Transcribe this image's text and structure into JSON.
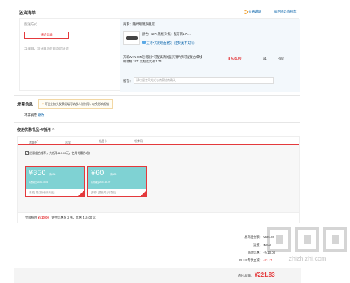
{
  "delivery": {
    "title": "送货清单",
    "price_note": "价格说明",
    "back_cart": "返回修改购物车",
    "method_label": "配送方式",
    "method_value": "快递运输",
    "delivery_time": "工作日、双休日与假日均可送货"
  },
  "item": {
    "seller": "商家：随昇眼镜旗舰店",
    "spec_line1": "颜色：1971黑框   对焦：配万新1.74...",
    "return_tag": "支持7天无理由退货（定制类不支持）",
    "name": "万新WAN XIN近视镜片可配高清防蓝光镜片男可配复古细线眼镜框 1971黑框 配万新1.74...",
    "price": "¥ 635.00",
    "qty": "x1",
    "stock": "有货",
    "remark_label": "留言：",
    "remark_placeholder": "请以留言同方式与商家协商确认"
  },
  "invoice": {
    "title": "发票信息",
    "notice": "开企业抬头发票须填写纳税人识别号，以免影响报销",
    "value": "不开发票",
    "edit": "修改"
  },
  "discount": {
    "title": "使用优惠/礼品卡/抵用",
    "tabs": [
      "优惠券",
      "京豆",
      "礼品卡",
      "领劵码"
    ],
    "checkbox_label": "优惠组合推荐，共抵用410.00元，使用优惠券2张",
    "coupons": [
      {
        "amount": "¥350",
        "cond": "满638",
        "date": "有效期至2024-10-31",
        "scope": "[东券] [限店铺使用商品]"
      },
      {
        "amount": "¥60",
        "cond": "满388",
        "date": "有效期至2024-10-07",
        "scope": "[东券] [限品类] [可叠加]"
      }
    ],
    "summary_label": "金额抵用",
    "summary_amount": "¥410.00",
    "summary_detail": "使用优惠券 2 张，优惠 410.00 元"
  },
  "totals": {
    "rows": [
      {
        "label": "总商品金额：",
        "value": "¥635.00"
      },
      {
        "label": "运费：",
        "value": "¥0.00"
      },
      {
        "label": "商品优惠：",
        "value": "-¥410.00"
      },
      {
        "label": "PLUS专享立减：",
        "value": "-¥3.17"
      }
    ],
    "payable_label": "应付总额：",
    "payable_value": "¥221.83"
  },
  "watermark": "zhizhizhi.com",
  "colors": {
    "red": "#e4393c",
    "blue": "#005ea7",
    "coupon": "#7fd2d3"
  }
}
